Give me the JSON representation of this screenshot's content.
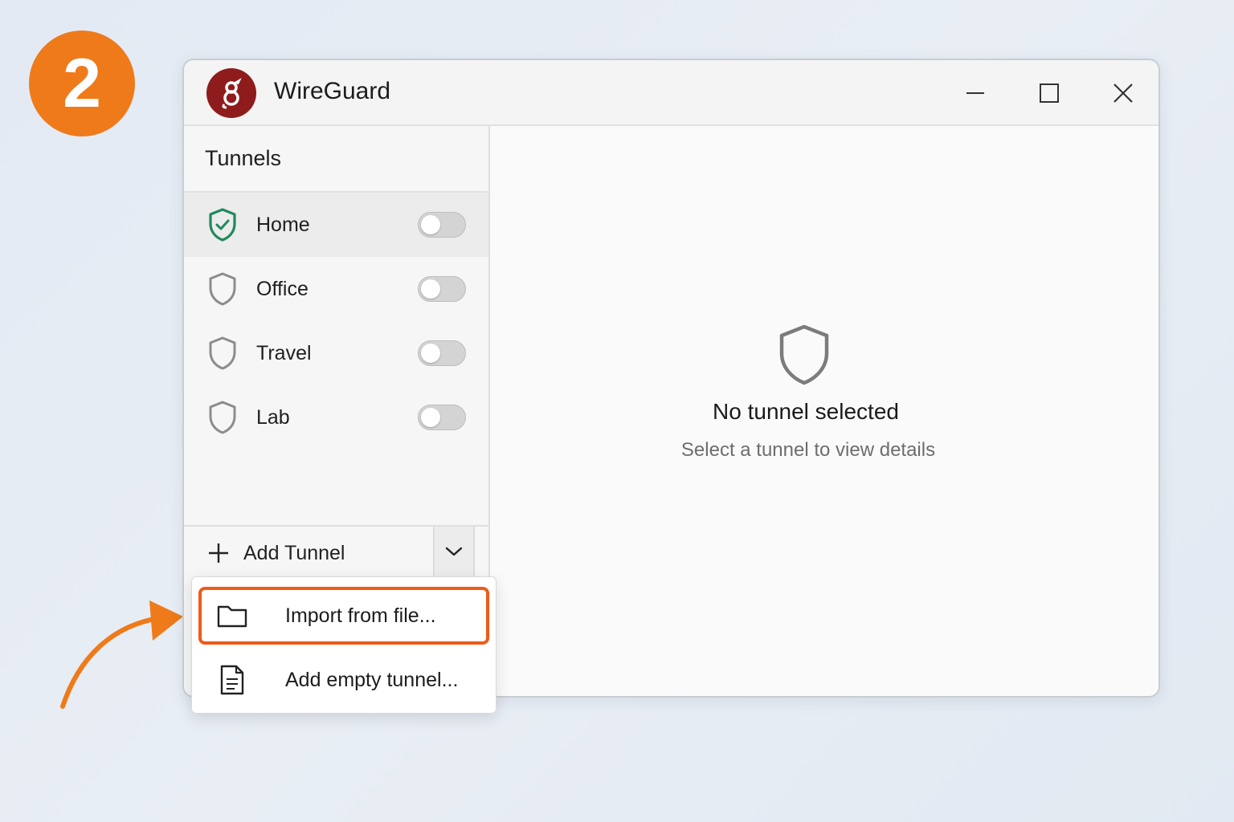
{
  "step_badge": {
    "number": "2",
    "color": "#ef7a1a"
  },
  "window": {
    "title": "WireGuard",
    "logo_icon": "wireguard-dragon-logo",
    "controls": [
      "minimize-icon",
      "maximize-icon",
      "close-icon"
    ]
  },
  "sidebar": {
    "title": "Tunnels",
    "tunnels": [
      {
        "name": "Home",
        "status_icon": "shield-check-icon",
        "selected": true,
        "active": false
      },
      {
        "name": "Office",
        "status_icon": "shield-icon",
        "selected": false,
        "active": false
      },
      {
        "name": "Travel",
        "status_icon": "shield-icon",
        "selected": false,
        "active": false
      },
      {
        "name": "Lab",
        "status_icon": "shield-icon",
        "selected": false,
        "active": false
      }
    ],
    "add_button": {
      "label": "Add Tunnel",
      "icon": "plus-icon",
      "dropdown_icon": "chevron-down-icon"
    }
  },
  "main": {
    "empty_icon": "shield-icon",
    "empty_title": "No tunnel selected",
    "empty_subtitle": "Select a tunnel to view details"
  },
  "dropdown_menu": {
    "items": [
      {
        "label": "Import from file...",
        "icon": "folder-icon",
        "highlighted": true
      },
      {
        "label": "Add empty tunnel...",
        "icon": "document-icon",
        "highlighted": false
      }
    ]
  },
  "colors": {
    "accent_orange": "#ef7a1a",
    "highlight_border": "#f05a1a",
    "active_shield": "#1f8a5b",
    "logo_red": "#8f1c1c"
  }
}
